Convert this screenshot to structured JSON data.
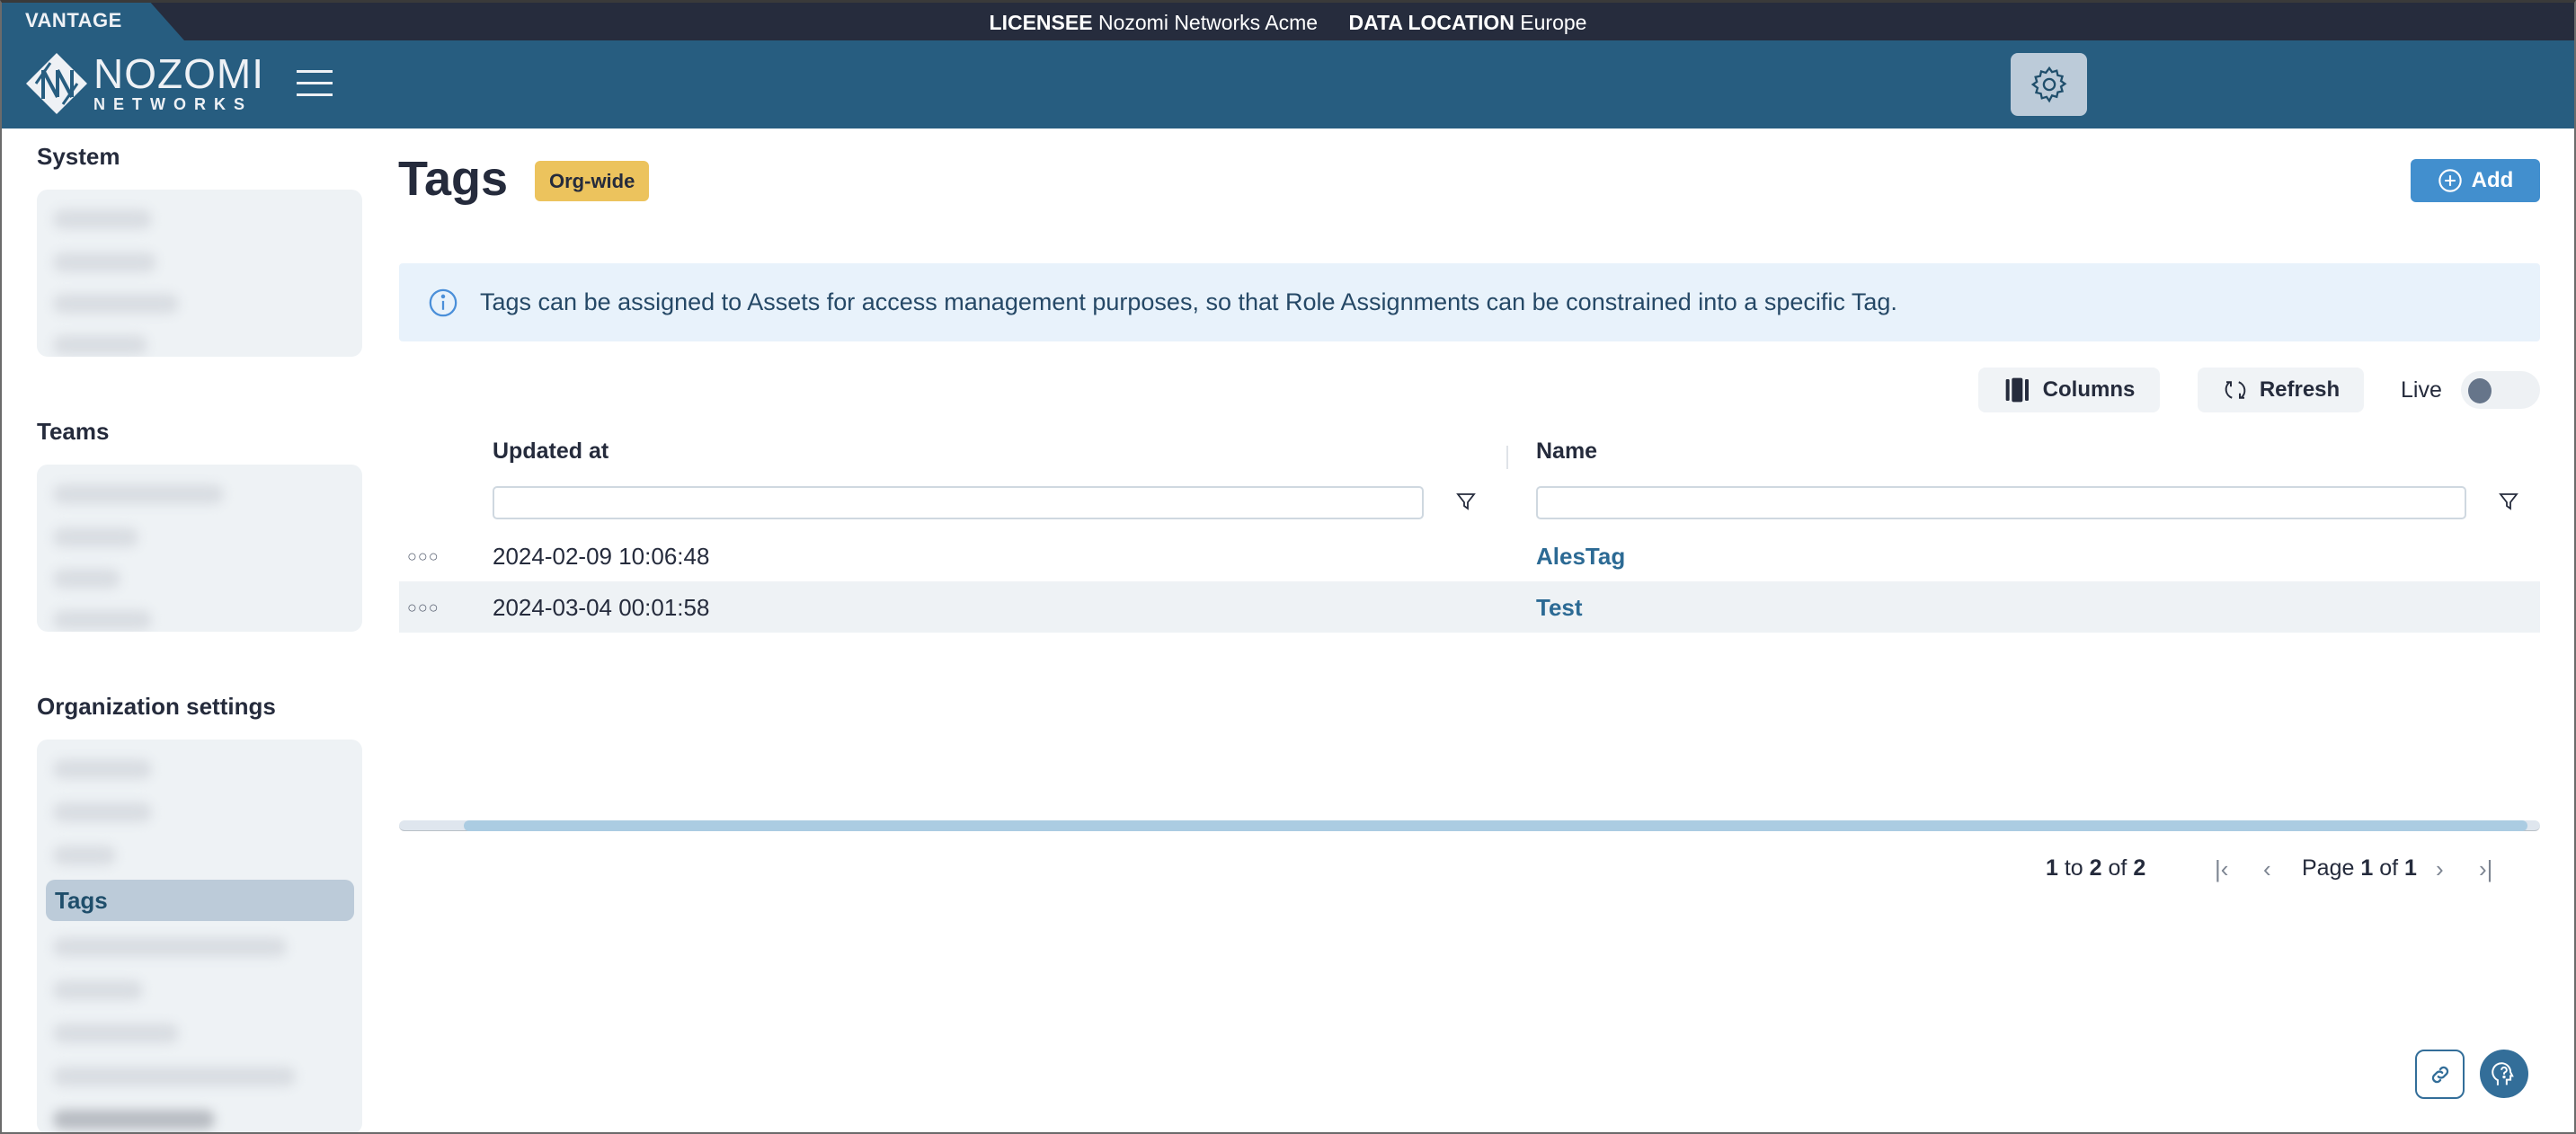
{
  "topbar": {
    "product": "VANTAGE",
    "licensee_label": "LICENSEE",
    "licensee_value": "Nozomi Networks Acme",
    "data_location_label": "DATA LOCATION",
    "data_location_value": "Europe"
  },
  "header": {
    "logo_main": "NOZOMI",
    "logo_sub": "NETWORKS",
    "menu_icon": "hamburger-icon",
    "settings_icon": "gear-icon"
  },
  "sidebar": {
    "sections": [
      {
        "title": "System",
        "items_redacted": 4
      },
      {
        "title": "Teams",
        "items_redacted": 4
      },
      {
        "title": "Organization settings",
        "items_redacted_before_active": 3,
        "active_item": "Tags",
        "items_redacted_after_active": 5
      }
    ]
  },
  "page": {
    "title": "Tags",
    "scope_badge": "Org-wide",
    "add_label": "Add",
    "info_text": "Tags can be assigned to Assets for access management purposes, so that Role Assignments can be constrained into a specific Tag."
  },
  "toolbar": {
    "columns_label": "Columns",
    "refresh_label": "Refresh",
    "live_label": "Live",
    "live_on": false
  },
  "table": {
    "columns": [
      {
        "header": "Updated at",
        "filter_value": ""
      },
      {
        "header": "Name",
        "filter_value": ""
      }
    ],
    "rows": [
      {
        "updated_at": "2024-02-09 10:06:48",
        "name": "AlesTag"
      },
      {
        "updated_at": "2024-03-04 00:01:58",
        "name": "Test"
      }
    ],
    "row_menu_glyph": "○○○"
  },
  "pagination": {
    "from": "1",
    "to_word": "to",
    "to": "2",
    "of_word": "of",
    "total": "2",
    "page_word": "Page",
    "page": "1",
    "page_of_word": "of",
    "page_count": "1"
  },
  "floating": {
    "link_icon": "link-icon",
    "help_icon": "help-head-icon"
  },
  "colors": {
    "topbar": "#262c3d",
    "header": "#275d80",
    "accent": "#428fce",
    "badge": "#ecc35d",
    "link": "#2c6a94",
    "active_nav": "#bccbd9"
  }
}
